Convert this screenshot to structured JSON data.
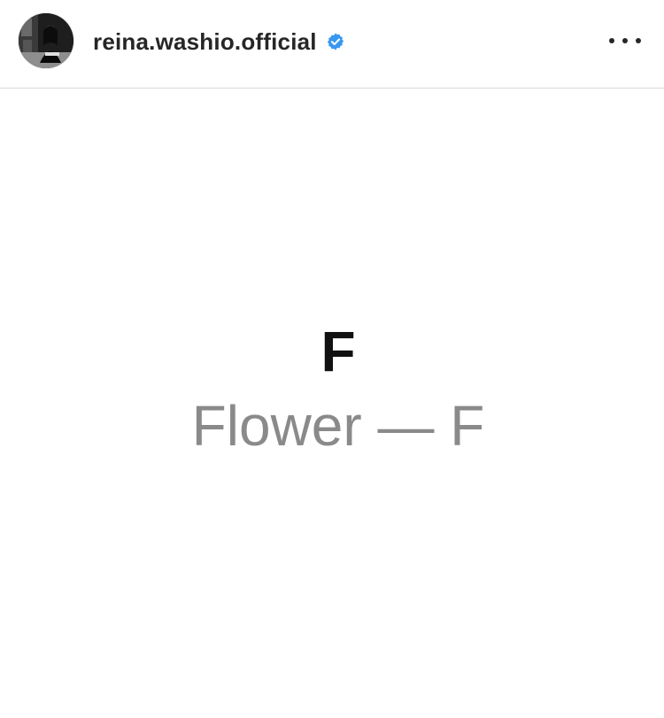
{
  "header": {
    "username": "reina.washio.official",
    "verified": true,
    "more_icon": "more-horizontal-icon"
  },
  "post": {
    "letter": "F",
    "caption": "Flower — F"
  },
  "colors": {
    "username": "#262626",
    "verified_badge": "#3897f0",
    "letter": "#111111",
    "caption": "#8a8a8a",
    "divider": "#dbdbdb"
  }
}
